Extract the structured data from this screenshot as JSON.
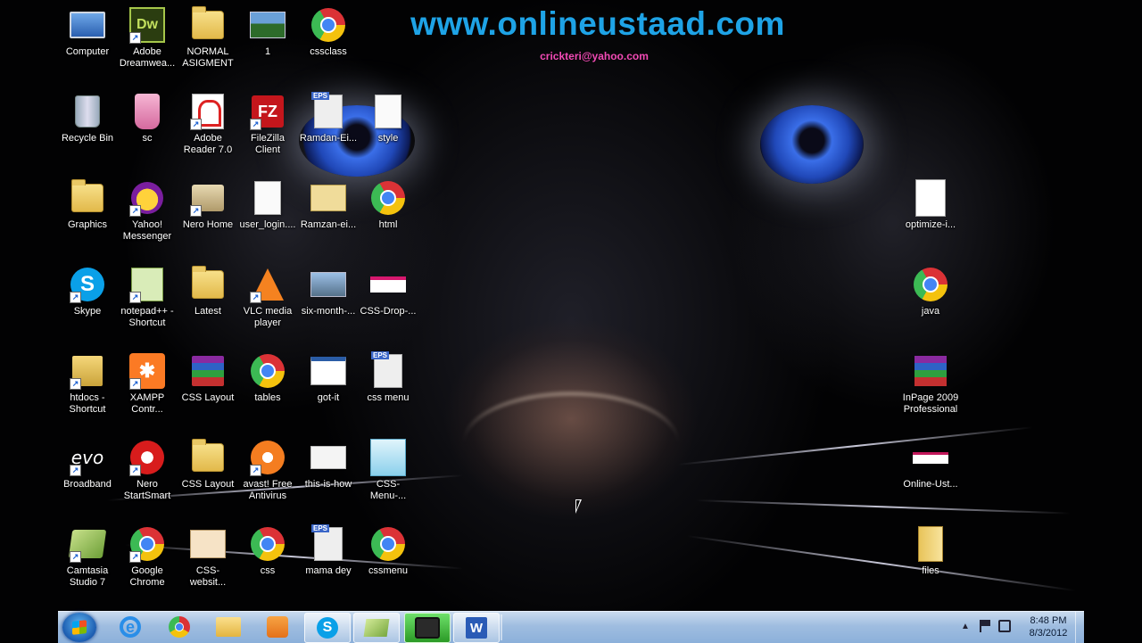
{
  "header": {
    "site": "www.onlineustaad.com",
    "email": "crickteri@yahoo.com"
  },
  "desktop_icons": [
    {
      "label": "Computer",
      "icon": "computer-icon"
    },
    {
      "label": "Adobe Dreamwea...",
      "icon": "dreamweaver-icon"
    },
    {
      "label": "NORMAL ASIGMENT",
      "icon": "folder-icon"
    },
    {
      "label": "1",
      "icon": "image-file-icon"
    },
    {
      "label": "cssclass",
      "icon": "chrome-icon"
    },
    {
      "label": "Recycle Bin",
      "icon": "recycle-bin-icon"
    },
    {
      "label": "sc",
      "icon": "image-file-icon"
    },
    {
      "label": "Adobe Reader 7.0",
      "icon": "adobe-reader-icon"
    },
    {
      "label": "FileZilla Client",
      "icon": "filezilla-icon"
    },
    {
      "label": "Ramdan-Ei...",
      "icon": "eps-file-icon"
    },
    {
      "label": "style",
      "icon": "document-icon"
    },
    {
      "label": "Graphics",
      "icon": "folder-icon"
    },
    {
      "label": "Yahoo! Messenger",
      "icon": "yahoo-messenger-icon"
    },
    {
      "label": "Nero Home",
      "icon": "nero-home-icon"
    },
    {
      "label": "user_login....",
      "icon": "document-icon"
    },
    {
      "label": "Ramzan-ei...",
      "icon": "image-file-icon"
    },
    {
      "label": "html",
      "icon": "chrome-icon"
    },
    {
      "label": "Skype",
      "icon": "skype-icon"
    },
    {
      "label": "notepad++ - Shortcut",
      "icon": "notepad-plus-plus-icon"
    },
    {
      "label": "Latest",
      "icon": "folder-icon"
    },
    {
      "label": "VLC media player",
      "icon": "vlc-icon"
    },
    {
      "label": "six-month-...",
      "icon": "image-file-icon"
    },
    {
      "label": "CSS-Drop-...",
      "icon": "image-file-icon"
    },
    {
      "label": "htdocs - Shortcut",
      "icon": "folder-shortcut-icon"
    },
    {
      "label": "XAMPP Contr...",
      "icon": "xampp-icon"
    },
    {
      "label": "CSS Layout",
      "icon": "winrar-icon"
    },
    {
      "label": "tables",
      "icon": "chrome-icon"
    },
    {
      "label": "got-it",
      "icon": "image-file-icon"
    },
    {
      "label": "css menu",
      "icon": "eps-file-icon"
    },
    {
      "label": "Broadband",
      "icon": "evo-broadband-icon"
    },
    {
      "label": "Nero StartSmart",
      "icon": "nero-startsmart-icon"
    },
    {
      "label": "CSS Layout",
      "icon": "folder-icon"
    },
    {
      "label": "avast! Free Antivirus",
      "icon": "avast-icon"
    },
    {
      "label": "this-is-how",
      "icon": "image-file-icon"
    },
    {
      "label": "CSS-Menu-...",
      "icon": "image-file-icon"
    },
    {
      "label": "Camtasia Studio 7",
      "icon": "camtasia-icon"
    },
    {
      "label": "Google Chrome",
      "icon": "chrome-icon"
    },
    {
      "label": "CSS-websit...",
      "icon": "image-file-icon"
    },
    {
      "label": "css",
      "icon": "chrome-icon"
    },
    {
      "label": "mama dey",
      "icon": "eps-file-icon"
    },
    {
      "label": "cssmenu",
      "icon": "chrome-icon"
    },
    {
      "label": "optimize-i...",
      "icon": "document-icon"
    },
    {
      "label": "java",
      "icon": "chrome-icon"
    },
    {
      "label": "InPage 2009 Professional",
      "icon": "inpage-icon"
    },
    {
      "label": "Online-Ust...",
      "icon": "image-file-icon"
    },
    {
      "label": "files",
      "icon": "folder-icon"
    }
  ],
  "taskbar": {
    "start": "windows-start-icon",
    "pinned": [
      {
        "icon": "internet-explorer-icon"
      },
      {
        "icon": "chrome-icon"
      },
      {
        "icon": "windows-explorer-icon"
      },
      {
        "icon": "media-player-icon"
      },
      {
        "icon": "skype-icon",
        "state": "active"
      },
      {
        "icon": "camtasia-icon",
        "state": "active"
      },
      {
        "icon": "camtasia-recorder-icon",
        "state": "highlighted"
      },
      {
        "icon": "word-icon",
        "state": "active"
      }
    ],
    "tray": {
      "time": "8:48 PM",
      "date": "8/3/2012"
    }
  },
  "colors": {
    "title": "#1ea3e6",
    "email": "#f24ab5",
    "taskbar": "#9fbde0"
  }
}
